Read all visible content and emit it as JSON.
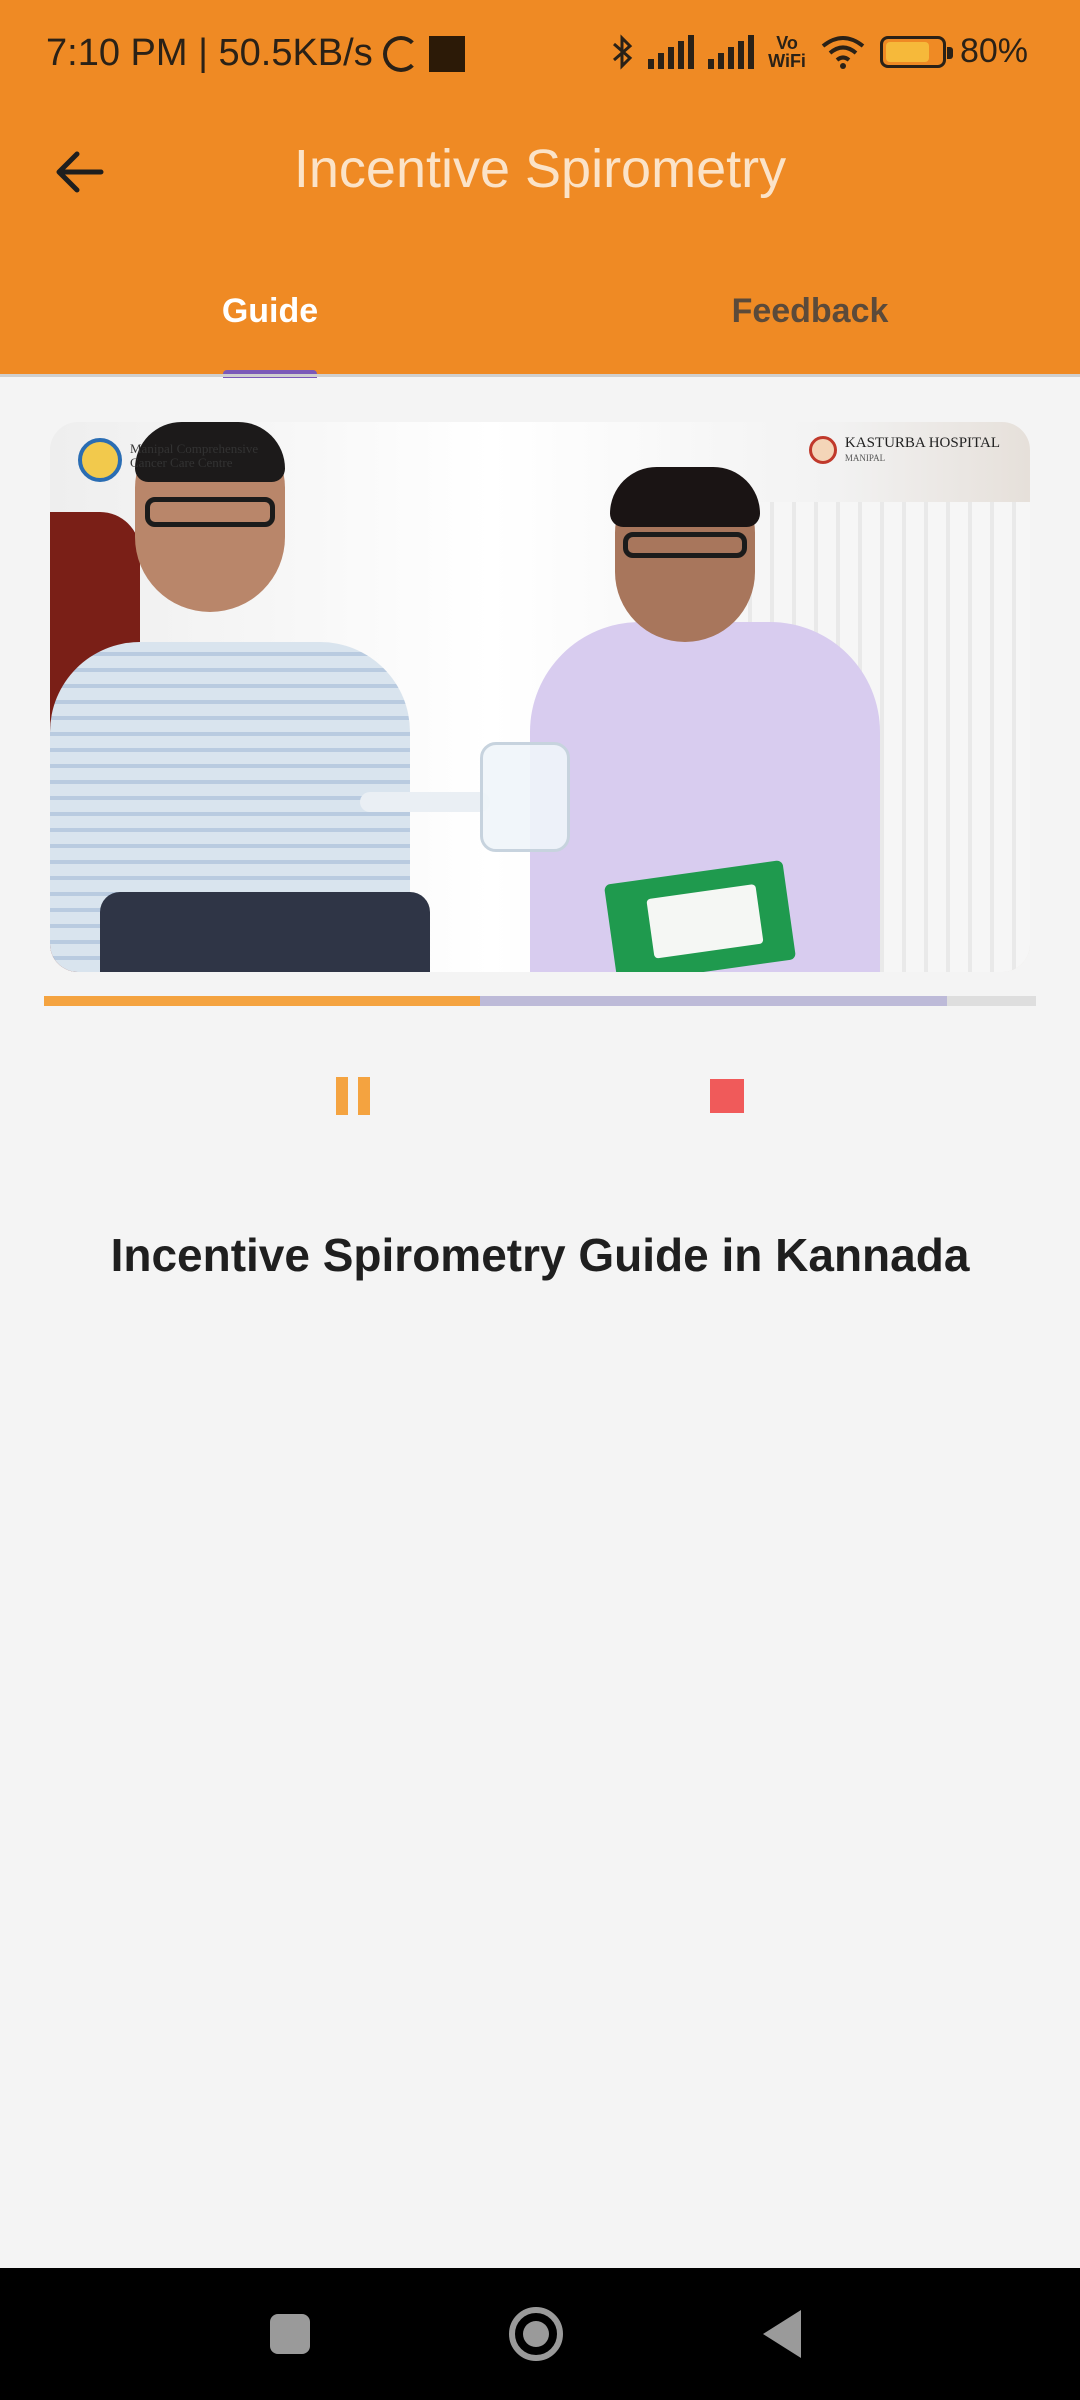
{
  "status_bar": {
    "time_speed": "7:10 PM | 50.5KB/s",
    "vowifi_top": "Vo",
    "vowifi_bottom": "WiFi",
    "battery": "80%",
    "battery_level": 0.8
  },
  "header": {
    "title": "Incentive Spirometry",
    "back_icon": "arrow-back-icon"
  },
  "tabs": [
    {
      "label": "Guide",
      "active": true
    },
    {
      "label": "Feedback",
      "active": false
    }
  ],
  "video": {
    "logo_left_text": "Manipal Comprehensive Cancer Care Centre",
    "logo_right_title": "KASTURBA HOSPITAL",
    "logo_right_sub": "MANIPAL",
    "played_fraction": 0.44,
    "buffered_fraction": 0.91
  },
  "controls": {
    "pause_icon": "pause-icon",
    "stop_icon": "stop-icon"
  },
  "video_title": "Incentive Spirometry Guide in Kannada",
  "colors": {
    "accent": "#ef8a24",
    "tab_indicator": "#7a58b8",
    "progress_played": "#f4a340",
    "progress_buffer": "#bdbad8",
    "stop": "#f05a5a",
    "background": "#f4f4f4"
  },
  "nav_bar": {
    "recent_icon": "recent-apps-icon",
    "home_icon": "home-icon",
    "back_icon": "back-triangle-icon"
  }
}
